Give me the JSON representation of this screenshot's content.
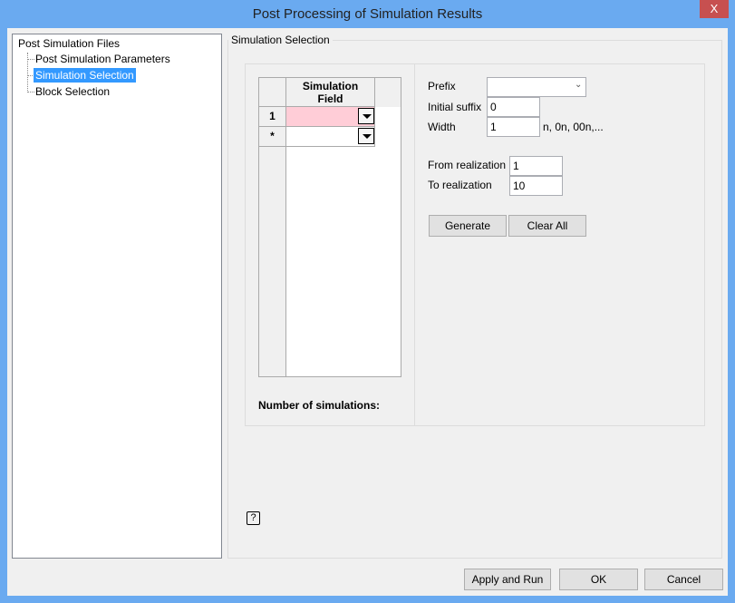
{
  "window": {
    "title": "Post Processing of Simulation Results",
    "close": "X"
  },
  "tree": {
    "root": "Post Simulation Files",
    "items": [
      "Post Simulation Parameters",
      "Simulation Selection",
      "Block Selection"
    ]
  },
  "group": {
    "title": "Simulation Selection"
  },
  "grid": {
    "header": "Simulation Field",
    "rows": [
      "1",
      "*"
    ]
  },
  "form": {
    "prefix_label": "Prefix",
    "prefix_value": "",
    "initial_suffix_label": "Initial suffix",
    "initial_suffix_value": "0",
    "width_label": "Width",
    "width_value": "1",
    "width_hint": "n, 0n, 00n,...",
    "from_label": "From realization",
    "from_value": "1",
    "to_label": "To realization",
    "to_value": "10"
  },
  "buttons": {
    "generate": "Generate",
    "clear_all": "Clear All",
    "apply": "Apply and Run",
    "ok": "OK",
    "cancel": "Cancel"
  },
  "count_label": "Number of simulations:",
  "help": "?"
}
